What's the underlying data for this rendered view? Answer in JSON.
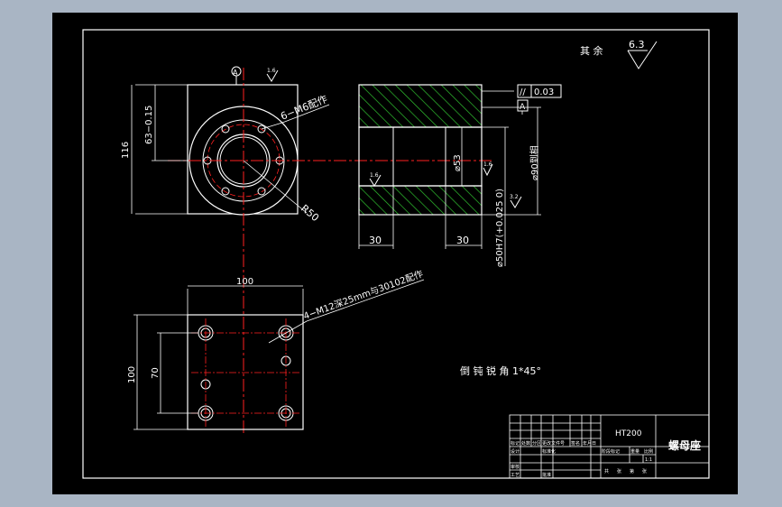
{
  "colors": {
    "outer_background": "#a9b5c4",
    "sheet": "#000000",
    "lines": "#ffffff",
    "center_lines": "#ff2020",
    "hatch": "#2fbf2f",
    "dimension_text": "#e6e6e6"
  },
  "surface_finish": {
    "prefix": "其  余",
    "value": "6.3"
  },
  "top_view": {
    "datum_top": "A",
    "roughness_top": "1.6",
    "dim_height": "116",
    "dim_offset": "63−0.15",
    "callout_holes": "6−M6配作",
    "radius": "R50"
  },
  "section_view": {
    "tolerance_symbol": "//",
    "tolerance_value": "0.03",
    "datum": "A",
    "dim_inner": "⌀53",
    "dim_outer": "⌀90到相",
    "dim_bore": "⌀50H7(+0.025 0)",
    "dim_left": "30",
    "dim_right": "30",
    "roughness_bore": "1.6",
    "roughness_outer": "3.2",
    "roughness_face": "1.6"
  },
  "bottom_view": {
    "dim_width": "100",
    "dim_height": "100",
    "dim_spacing": "70",
    "callout_holes": "4−M12深25mm与30102配作"
  },
  "note_chamfer": "倒  钝  锐  角   1*45°",
  "title_block": {
    "material": "HT200",
    "part_name": "螺母座",
    "row_labels": [
      "标记",
      "处数",
      "分区",
      "更改文件号",
      "签名",
      "年月日"
    ],
    "bottom_labels": [
      "设计",
      "标准化",
      "审核",
      "工艺",
      "批准"
    ],
    "stage_labels": [
      "阶段标记",
      "重量",
      "比例"
    ],
    "scale": "1:1",
    "sheet_labels": [
      "共",
      "张",
      "第",
      "张"
    ]
  }
}
